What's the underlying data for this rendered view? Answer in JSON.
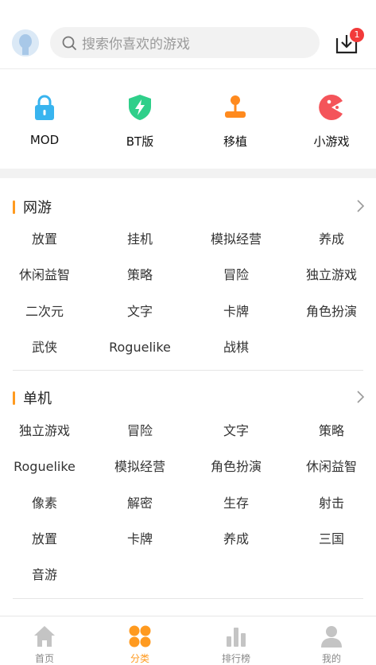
{
  "header": {
    "search_placeholder": "搜索你喜欢的游戏",
    "download_badge": "1"
  },
  "quick_categories": [
    {
      "label": "MOD",
      "icon": "lock-icon",
      "color": "#38b4ef"
    },
    {
      "label": "BT版",
      "icon": "shield-lightning-icon",
      "color": "#2fcf8a"
    },
    {
      "label": "移植",
      "icon": "joystick-icon",
      "color": "#ff8a1e"
    },
    {
      "label": "小游戏",
      "icon": "pacman-icon",
      "color": "#f4545a"
    }
  ],
  "sections": [
    {
      "title": "网游",
      "tags": [
        "放置",
        "挂机",
        "模拟经营",
        "养成",
        "休闲益智",
        "策略",
        "冒险",
        "独立游戏",
        "二次元",
        "文字",
        "卡牌",
        "角色扮演",
        "武侠",
        "Roguelike",
        "战棋"
      ]
    },
    {
      "title": "单机",
      "tags": [
        "独立游戏",
        "冒险",
        "文字",
        "策略",
        "Roguelike",
        "模拟经营",
        "角色扮演",
        "休闲益智",
        "像素",
        "解密",
        "生存",
        "射击",
        "放置",
        "卡牌",
        "养成",
        "三国",
        "音游"
      ]
    }
  ],
  "tabbar": [
    {
      "label": "首页",
      "icon": "home-icon"
    },
    {
      "label": "分类",
      "icon": "category-icon",
      "active": true
    },
    {
      "label": "排行榜",
      "icon": "ranking-icon"
    },
    {
      "label": "我的",
      "icon": "user-icon"
    }
  ],
  "colors": {
    "accent": "#ff9a1f",
    "badge": "#f23a3a"
  }
}
